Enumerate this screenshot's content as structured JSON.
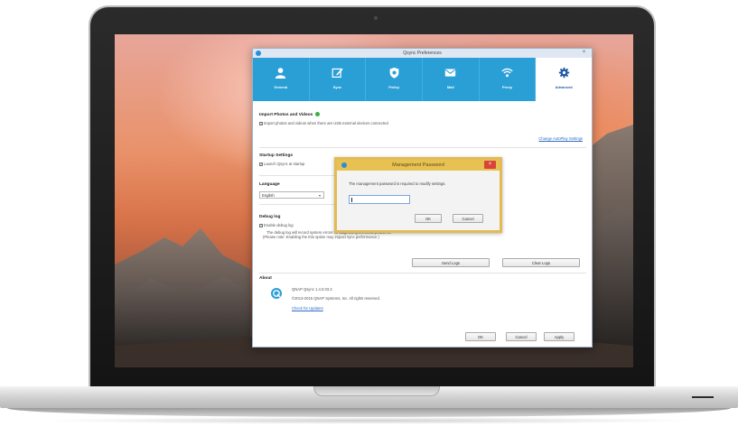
{
  "window": {
    "title": "Qsync Preferences",
    "close_glyph": "×"
  },
  "tabs": [
    {
      "label": "General",
      "icon": "user-icon"
    },
    {
      "label": "Sync",
      "icon": "edit-icon"
    },
    {
      "label": "Policy",
      "icon": "shield-icon"
    },
    {
      "label": "Mail",
      "icon": "mail-icon"
    },
    {
      "label": "Proxy",
      "icon": "wifi-icon"
    },
    {
      "label": "Advanced",
      "icon": "gear-icon"
    }
  ],
  "import_section": {
    "heading": "Import Photos and Videos",
    "checkbox_label": "Import photos and videos when there are USB external devices connected",
    "link": "Change AutoPlay Settings"
  },
  "startup_section": {
    "heading": "Startup Settings",
    "checkbox_label": "Launch Qsync at startup"
  },
  "language_section": {
    "heading": "Language",
    "selected": "English"
  },
  "debug_section": {
    "heading": "Debug log",
    "checkbox_label": "Enable debug log",
    "note_line1": "The debug log will record system errors for diagnosing technical problems.",
    "note_line2": "(Please note: Enabling the this option may impact sync performance.)",
    "send_logs_label": "Send Logs",
    "clear_logs_label": "Clear Logs"
  },
  "about_section": {
    "heading": "About",
    "version": "QNAP Qsync 1.4.0.03.3",
    "copyright": "©2013-2015 QNAP Systems, Inc. All rights reserved.",
    "check_updates": "Check for Updates"
  },
  "footer": {
    "ok_label": "OK",
    "cancel_label": "Cancel",
    "apply_label": "Apply"
  },
  "dialog": {
    "title": "Management Password",
    "message": "The management password is required to modify settings.",
    "password_value": "",
    "ok_label": "OK",
    "cancel_label": "Cancel",
    "close_glyph": "×"
  },
  "colors": {
    "tab_blue": "#2a9fd6",
    "dialog_gold": "#e3bb54",
    "close_red": "#d9433a",
    "link_blue": "#2b6cc4"
  }
}
